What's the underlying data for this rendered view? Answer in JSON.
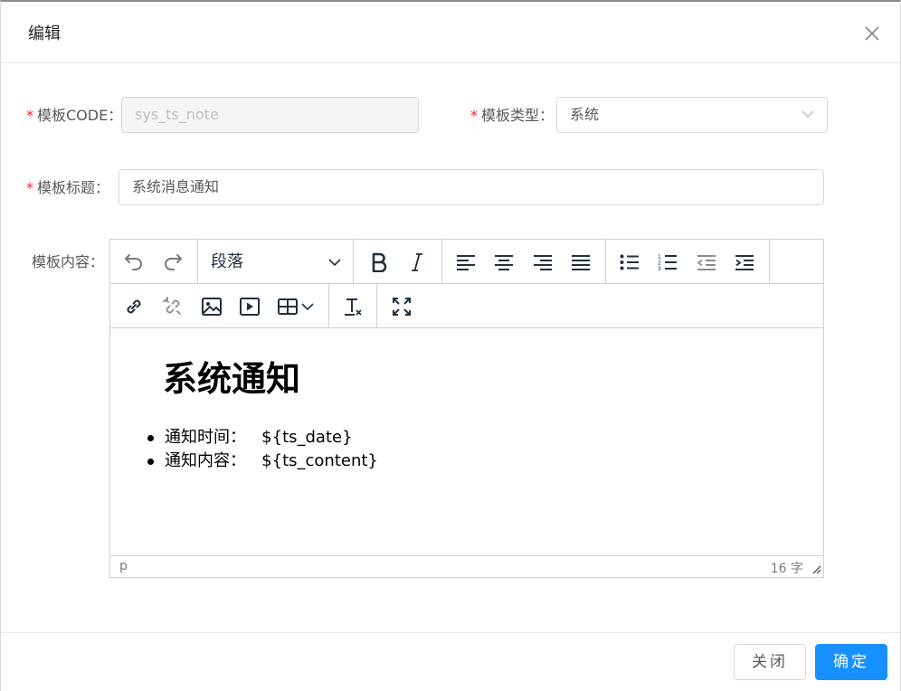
{
  "modal": {
    "title": "编辑"
  },
  "form": {
    "code": {
      "label": "模板CODE",
      "colon": "：",
      "required_mark": "*",
      "value": "sys_ts_note"
    },
    "type": {
      "label": "模板类型",
      "colon": "：",
      "required_mark": "*",
      "value": "系统"
    },
    "title": {
      "label": "模板标题",
      "colon": "：",
      "required_mark": "*",
      "value": "系统消息通知"
    },
    "content": {
      "label": "模板内容",
      "colon": "："
    }
  },
  "editor": {
    "block_format": "段落",
    "heading": "系统通知",
    "list_items": [
      "通知时间：   ${ts_date}",
      "通知内容：   ${ts_content}"
    ],
    "status_path": "p",
    "word_count": "16 字",
    "icons": [
      "undo-icon",
      "redo-icon",
      "bold-icon",
      "italic-icon",
      "align-left-icon",
      "align-center-icon",
      "align-right-icon",
      "align-justify-icon",
      "bullet-list-icon",
      "numbered-list-icon",
      "outdent-icon",
      "indent-icon",
      "link-icon",
      "unlink-icon",
      "image-icon",
      "media-icon",
      "table-icon",
      "clear-format-icon",
      "fullscreen-icon"
    ]
  },
  "footer": {
    "close_label": "关闭",
    "ok_label": "确定"
  },
  "colors": {
    "primary": "#1890ff",
    "required": "#f5222d",
    "icon": "#222f3e"
  }
}
